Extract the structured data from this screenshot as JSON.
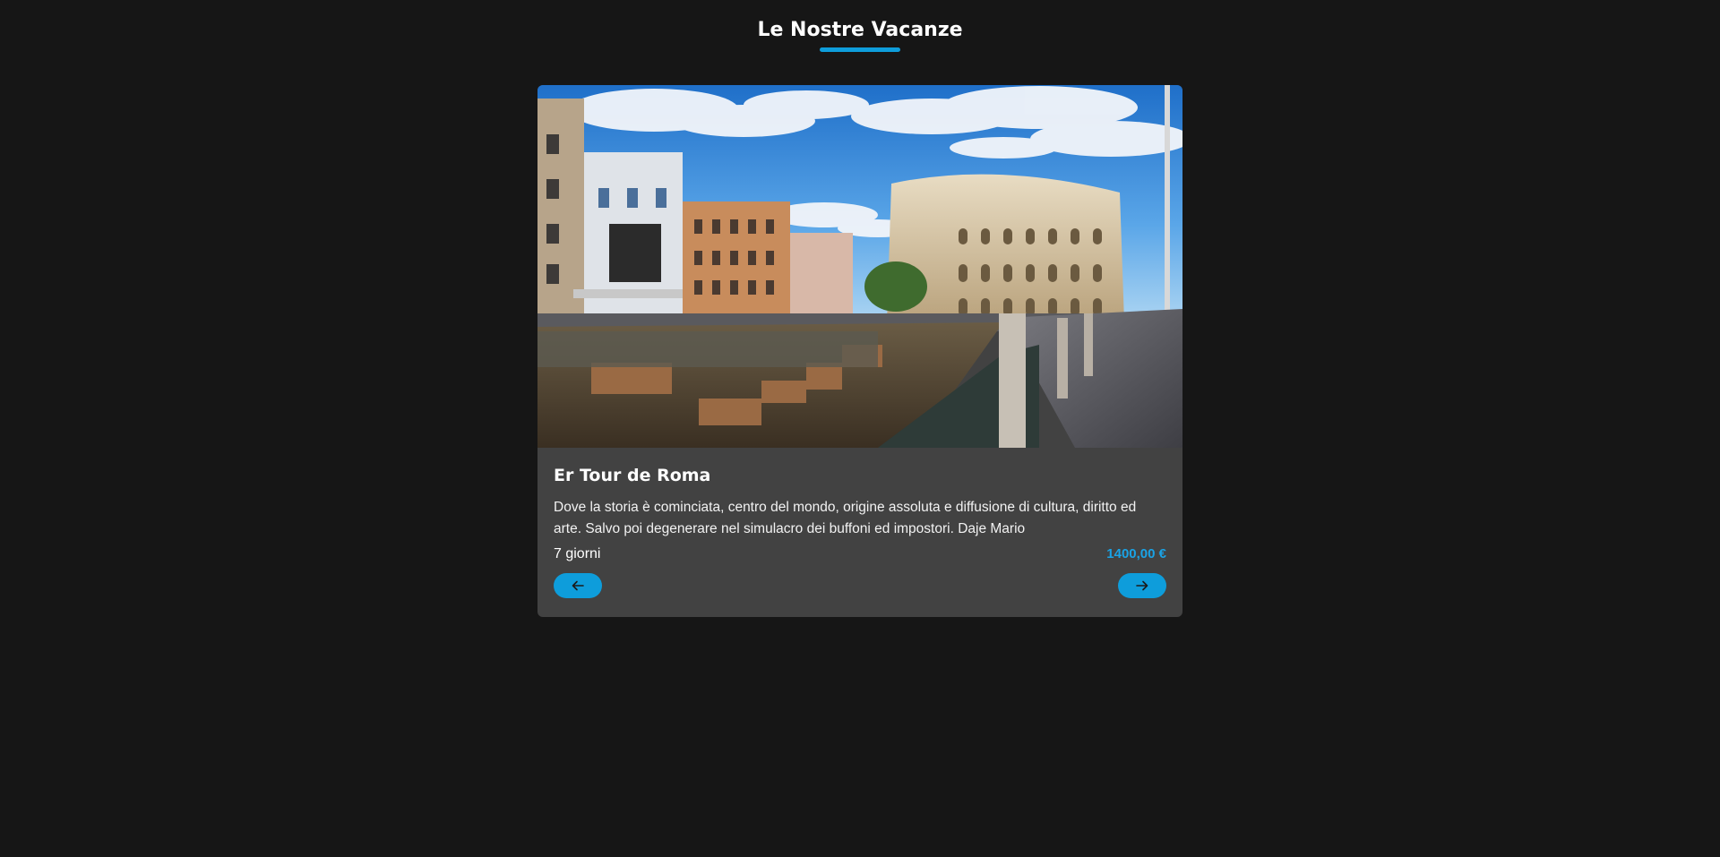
{
  "header": {
    "title": "Le Nostre Vacanze",
    "accent_color": "#0e9ddb"
  },
  "card": {
    "image_alt": "Colosseum and Roman ruins",
    "title": "Er Tour de Roma",
    "description": "Dove la storia è cominciata, centro del mondo, origine assoluta e diffusione di cultura, diritto ed arte. Salvo poi degenerare nel simulacro dei buffoni ed impostori. Daje Mario",
    "duration": "7 giorni",
    "price": "1400,00 €",
    "prev_icon": "arrow-left-icon",
    "next_icon": "arrow-right-icon",
    "background_color": "#424242",
    "price_color": "#1aa3e6"
  }
}
